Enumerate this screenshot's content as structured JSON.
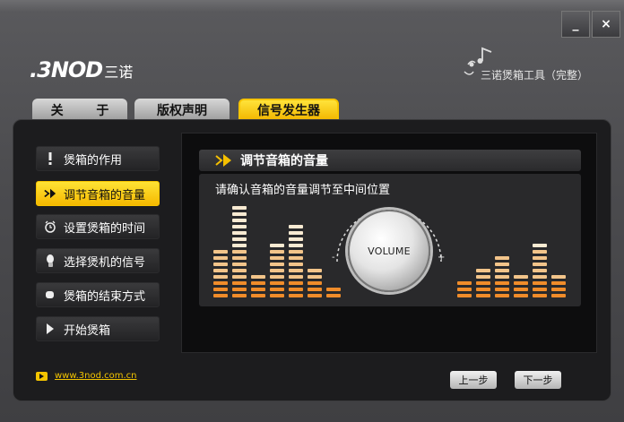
{
  "window": {
    "minimize_label": "_",
    "close_label": "×"
  },
  "brand": {
    "logo_text": ".3NOD",
    "logo_cn": "三诺",
    "app_title": "三诺煲箱工具（完整）"
  },
  "tabs": [
    {
      "label": "关 于"
    },
    {
      "label": "版权声明"
    },
    {
      "label": "信号发生器",
      "active": true
    }
  ],
  "sidebar": {
    "items": [
      {
        "label": "煲箱的作用",
        "icon": "exclamation-icon"
      },
      {
        "label": "调节音箱的音量",
        "icon": "play-arrow-icon",
        "active": true
      },
      {
        "label": "设置煲箱的时间",
        "icon": "alarm-clock-icon"
      },
      {
        "label": "选择煲机的信号",
        "icon": "signal-icon"
      },
      {
        "label": "煲箱的结束方式",
        "icon": "stop-icon"
      },
      {
        "label": "开始煲箱",
        "icon": "play-icon"
      }
    ]
  },
  "footer": {
    "website": "www.3nod.com.cn"
  },
  "content": {
    "header": "调节音箱的音量",
    "instruction": "请确认音箱的音量调节至中间位置",
    "knob_label": "VOLUME",
    "knob_minus": "-",
    "knob_plus": "+"
  },
  "equalizer": {
    "left_levels": [
      8,
      15,
      4,
      9,
      12,
      5,
      2
    ],
    "right_levels": [
      3,
      5,
      7,
      4,
      9,
      4
    ],
    "colors": {
      "low": "#f08c2a",
      "mid": "#f2c48a",
      "high": "#f8ead2"
    }
  },
  "nav": {
    "prev_label": "上一步",
    "next_label": "下一步"
  },
  "colors": {
    "accent_yellow": "#f5c000",
    "panel_dark": "#1c1c1e"
  }
}
